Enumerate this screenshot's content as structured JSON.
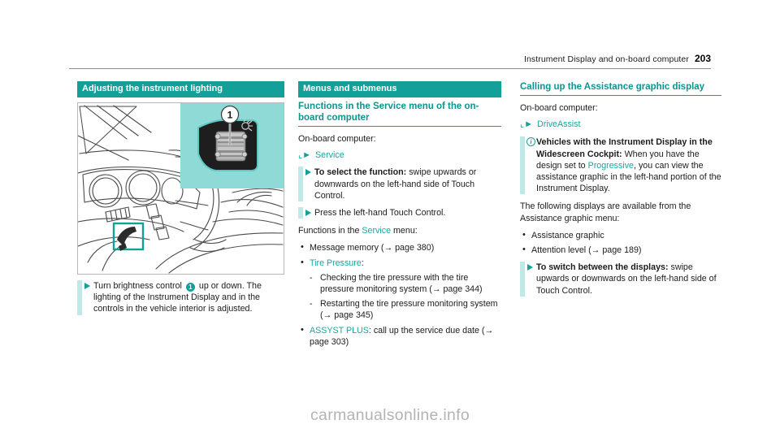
{
  "running_head": {
    "title": "Instrument Display and on-board computer",
    "page_number": "203"
  },
  "colors": {
    "teal": "#13a098",
    "teal_text": "#16a79f",
    "accent_bar": "#bfe8e6",
    "figure_panel": "#8fd9d6"
  },
  "column_left": {
    "heading": "Adjusting the instrument lighting",
    "figure": {
      "name": "dashboard-instrument-lighting-illustration",
      "callout_number": "1",
      "inset_icon": "brightness-lamp-icon"
    },
    "instruction": {
      "marker": "triangle-bullet",
      "text_before": "Turn brightness control",
      "callout": "1",
      "text_after": "up or down.",
      "detail": "The lighting of the Instrument Display and in the controls in the vehicle interior is adjusted."
    }
  },
  "column_middle": {
    "bar_heading": "Menus and submenus",
    "sub_heading": "Functions in the Service menu of the on-board computer",
    "intro": "On-board computer:",
    "menu_path": {
      "glyph": "path-arrow-icon",
      "label": "Service"
    },
    "instructions": [
      {
        "bold": "To select the function:",
        "rest": " swipe upwards or downwards on the left-hand side of Touch Control."
      },
      {
        "bold": "",
        "rest": "Press the left-hand Touch Control."
      }
    ],
    "list_intro_before": "Functions in the ",
    "list_intro_link": "Service",
    "list_intro_after": " menu:",
    "items": [
      {
        "text": "Message memory (→ page 380)",
        "link": "",
        "subitems": []
      },
      {
        "link": "Tire Pressure",
        "text": ":",
        "subitems": [
          "Checking the tire pressure with the tire pressure monitoring system (→ page 344)",
          "Restarting the tire pressure monitoring system (→ page 345)"
        ]
      },
      {
        "link": "ASSYST PLUS",
        "text": ": call up the service due date (→ page 303)",
        "subitems": []
      }
    ]
  },
  "column_right": {
    "heading": "Calling up the Assistance graphic display",
    "intro": "On-board computer:",
    "menu_path": {
      "glyph": "path-arrow-icon",
      "label": "DriveAssist"
    },
    "note": {
      "icon": "info-icon",
      "bold": "Vehicles with the Instrument Display in the Widescreen Cockpit:",
      "rest_before": " When you have the design set to ",
      "link": "Progressive",
      "rest_after": ", you can view the assistance graphic in the left-hand portion of the Instrument Display."
    },
    "list_intro": "The following displays are available from the Assistance graphic menu:",
    "items": [
      "Assistance graphic",
      "Attention level (→ page 189)"
    ],
    "instruction": {
      "bold": "To switch between the displays:",
      "rest": " swipe upwards or downwards on the left-hand side of Touch Control."
    }
  },
  "watermark": "carmanualsonline.info"
}
